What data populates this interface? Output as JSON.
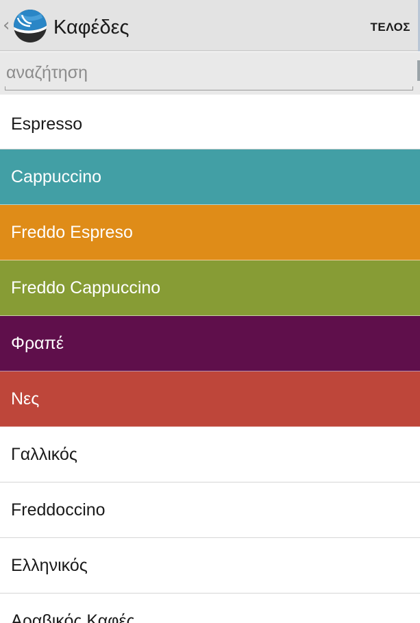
{
  "actionbar": {
    "title": "Καφέδες",
    "done_label": "ΤΕΛΟΣ",
    "up_caret": "‹"
  },
  "search": {
    "placeholder": "αναζήτηση",
    "value": ""
  },
  "coffees": [
    {
      "label": "Espresso",
      "bg": "#ffffff",
      "fg": "#1a1a1a"
    },
    {
      "label": "Cappuccino",
      "bg": "#429fa5",
      "fg": "#ffffff"
    },
    {
      "label": "Freddo Espreso",
      "bg": "#df8c18",
      "fg": "#ffffff"
    },
    {
      "label": "Freddo Cappuccino",
      "bg": "#879c35",
      "fg": "#ffffff"
    },
    {
      "label": "Φραπέ",
      "bg": "#5f0f4b",
      "fg": "#ffffff"
    },
    {
      "label": "Νες",
      "bg": "#be463a",
      "fg": "#ffffff"
    },
    {
      "label": "Γαλλικός",
      "bg": "#ffffff",
      "fg": "#1a1a1a"
    },
    {
      "label": "Freddoccino",
      "bg": "#ffffff",
      "fg": "#1a1a1a"
    },
    {
      "label": "Ελληνικός",
      "bg": "#ffffff",
      "fg": "#1a1a1a"
    },
    {
      "label": "Αραβικός Καφές",
      "bg": "#ffffff",
      "fg": "#1a1a1a"
    }
  ],
  "icons": {
    "logo": "coffee-cup-logo-icon",
    "up": "chevron-left-icon"
  },
  "colors": {
    "actionbar_bg": "#e3e3e3",
    "search_bg": "#e9e9e9",
    "logo_blue": "#2a86c6",
    "logo_dark": "#2c2c2c"
  }
}
